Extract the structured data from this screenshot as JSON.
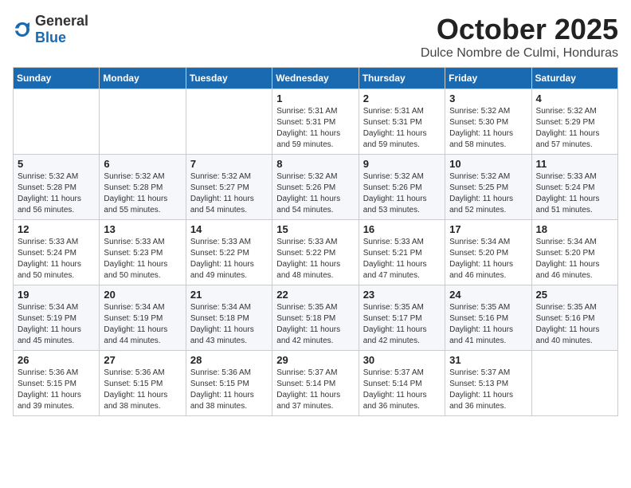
{
  "header": {
    "logo_general": "General",
    "logo_blue": "Blue",
    "month": "October 2025",
    "location": "Dulce Nombre de Culmi, Honduras"
  },
  "days_of_week": [
    "Sunday",
    "Monday",
    "Tuesday",
    "Wednesday",
    "Thursday",
    "Friday",
    "Saturday"
  ],
  "weeks": [
    [
      {
        "day": "",
        "info": ""
      },
      {
        "day": "",
        "info": ""
      },
      {
        "day": "",
        "info": ""
      },
      {
        "day": "1",
        "info": "Sunrise: 5:31 AM\nSunset: 5:31 PM\nDaylight: 11 hours\nand 59 minutes."
      },
      {
        "day": "2",
        "info": "Sunrise: 5:31 AM\nSunset: 5:31 PM\nDaylight: 11 hours\nand 59 minutes."
      },
      {
        "day": "3",
        "info": "Sunrise: 5:32 AM\nSunset: 5:30 PM\nDaylight: 11 hours\nand 58 minutes."
      },
      {
        "day": "4",
        "info": "Sunrise: 5:32 AM\nSunset: 5:29 PM\nDaylight: 11 hours\nand 57 minutes."
      }
    ],
    [
      {
        "day": "5",
        "info": "Sunrise: 5:32 AM\nSunset: 5:28 PM\nDaylight: 11 hours\nand 56 minutes."
      },
      {
        "day": "6",
        "info": "Sunrise: 5:32 AM\nSunset: 5:28 PM\nDaylight: 11 hours\nand 55 minutes."
      },
      {
        "day": "7",
        "info": "Sunrise: 5:32 AM\nSunset: 5:27 PM\nDaylight: 11 hours\nand 54 minutes."
      },
      {
        "day": "8",
        "info": "Sunrise: 5:32 AM\nSunset: 5:26 PM\nDaylight: 11 hours\nand 54 minutes."
      },
      {
        "day": "9",
        "info": "Sunrise: 5:32 AM\nSunset: 5:26 PM\nDaylight: 11 hours\nand 53 minutes."
      },
      {
        "day": "10",
        "info": "Sunrise: 5:32 AM\nSunset: 5:25 PM\nDaylight: 11 hours\nand 52 minutes."
      },
      {
        "day": "11",
        "info": "Sunrise: 5:33 AM\nSunset: 5:24 PM\nDaylight: 11 hours\nand 51 minutes."
      }
    ],
    [
      {
        "day": "12",
        "info": "Sunrise: 5:33 AM\nSunset: 5:24 PM\nDaylight: 11 hours\nand 50 minutes."
      },
      {
        "day": "13",
        "info": "Sunrise: 5:33 AM\nSunset: 5:23 PM\nDaylight: 11 hours\nand 50 minutes."
      },
      {
        "day": "14",
        "info": "Sunrise: 5:33 AM\nSunset: 5:22 PM\nDaylight: 11 hours\nand 49 minutes."
      },
      {
        "day": "15",
        "info": "Sunrise: 5:33 AM\nSunset: 5:22 PM\nDaylight: 11 hours\nand 48 minutes."
      },
      {
        "day": "16",
        "info": "Sunrise: 5:33 AM\nSunset: 5:21 PM\nDaylight: 11 hours\nand 47 minutes."
      },
      {
        "day": "17",
        "info": "Sunrise: 5:34 AM\nSunset: 5:20 PM\nDaylight: 11 hours\nand 46 minutes."
      },
      {
        "day": "18",
        "info": "Sunrise: 5:34 AM\nSunset: 5:20 PM\nDaylight: 11 hours\nand 46 minutes."
      }
    ],
    [
      {
        "day": "19",
        "info": "Sunrise: 5:34 AM\nSunset: 5:19 PM\nDaylight: 11 hours\nand 45 minutes."
      },
      {
        "day": "20",
        "info": "Sunrise: 5:34 AM\nSunset: 5:19 PM\nDaylight: 11 hours\nand 44 minutes."
      },
      {
        "day": "21",
        "info": "Sunrise: 5:34 AM\nSunset: 5:18 PM\nDaylight: 11 hours\nand 43 minutes."
      },
      {
        "day": "22",
        "info": "Sunrise: 5:35 AM\nSunset: 5:18 PM\nDaylight: 11 hours\nand 42 minutes."
      },
      {
        "day": "23",
        "info": "Sunrise: 5:35 AM\nSunset: 5:17 PM\nDaylight: 11 hours\nand 42 minutes."
      },
      {
        "day": "24",
        "info": "Sunrise: 5:35 AM\nSunset: 5:16 PM\nDaylight: 11 hours\nand 41 minutes."
      },
      {
        "day": "25",
        "info": "Sunrise: 5:35 AM\nSunset: 5:16 PM\nDaylight: 11 hours\nand 40 minutes."
      }
    ],
    [
      {
        "day": "26",
        "info": "Sunrise: 5:36 AM\nSunset: 5:15 PM\nDaylight: 11 hours\nand 39 minutes."
      },
      {
        "day": "27",
        "info": "Sunrise: 5:36 AM\nSunset: 5:15 PM\nDaylight: 11 hours\nand 38 minutes."
      },
      {
        "day": "28",
        "info": "Sunrise: 5:36 AM\nSunset: 5:15 PM\nDaylight: 11 hours\nand 38 minutes."
      },
      {
        "day": "29",
        "info": "Sunrise: 5:37 AM\nSunset: 5:14 PM\nDaylight: 11 hours\nand 37 minutes."
      },
      {
        "day": "30",
        "info": "Sunrise: 5:37 AM\nSunset: 5:14 PM\nDaylight: 11 hours\nand 36 minutes."
      },
      {
        "day": "31",
        "info": "Sunrise: 5:37 AM\nSunset: 5:13 PM\nDaylight: 11 hours\nand 36 minutes."
      },
      {
        "day": "",
        "info": ""
      }
    ]
  ]
}
